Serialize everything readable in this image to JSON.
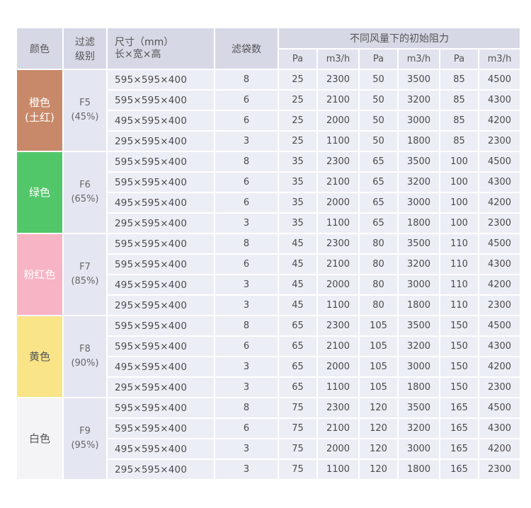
{
  "header": {
    "color": "颜色",
    "grade_line1": "过滤",
    "grade_line2": "级别",
    "size_line1": "尺寸（mm）",
    "size_line2": "长×宽×高",
    "bags": "滤袋数",
    "resistance": "不同风量下的初始阻力",
    "sub": [
      "Pa",
      "m3/h",
      "Pa",
      "m3/h",
      "Pa",
      "m3/h"
    ]
  },
  "groups": [
    {
      "color_line1": "橙色",
      "color_line2": "(土红)",
      "swatch": "#c8896a",
      "swatch_text": "#ffffff",
      "grade": "F5",
      "efficiency": "(45%)",
      "rows": [
        {
          "size": "595×595×400",
          "bags": "8",
          "v": [
            "25",
            "2300",
            "50",
            "3500",
            "85",
            "4500"
          ]
        },
        {
          "size": "595×595×400",
          "bags": "6",
          "v": [
            "25",
            "2100",
            "50",
            "3200",
            "85",
            "4300"
          ]
        },
        {
          "size": "495×595×400",
          "bags": "6",
          "v": [
            "25",
            "2000",
            "50",
            "3000",
            "85",
            "4200"
          ]
        },
        {
          "size": "295×595×400",
          "bags": "3",
          "v": [
            "25",
            "1100",
            "50",
            "1800",
            "85",
            "2300"
          ]
        }
      ]
    },
    {
      "color_line1": "绿色",
      "color_line2": "",
      "swatch": "#52c76a",
      "swatch_text": "#ffffff",
      "grade": "F6",
      "efficiency": "(65%)",
      "rows": [
        {
          "size": "595×595×400",
          "bags": "8",
          "v": [
            "35",
            "2300",
            "65",
            "3500",
            "100",
            "4500"
          ]
        },
        {
          "size": "595×595×400",
          "bags": "6",
          "v": [
            "35",
            "2100",
            "65",
            "3200",
            "100",
            "4300"
          ]
        },
        {
          "size": "495×595×400",
          "bags": "6",
          "v": [
            "35",
            "2000",
            "65",
            "3000",
            "100",
            "4200"
          ]
        },
        {
          "size": "295×595×400",
          "bags": "3",
          "v": [
            "35",
            "1100",
            "65",
            "1800",
            "100",
            "2300"
          ]
        }
      ]
    },
    {
      "color_line1": "粉红色",
      "color_line2": "",
      "swatch": "#f6b4c4",
      "swatch_text": "#ffffff",
      "grade": "F7",
      "efficiency": "(85%)",
      "rows": [
        {
          "size": "595×595×400",
          "bags": "8",
          "v": [
            "45",
            "2300",
            "80",
            "3500",
            "110",
            "4500"
          ]
        },
        {
          "size": "595×595×400",
          "bags": "6",
          "v": [
            "45",
            "2100",
            "80",
            "3200",
            "110",
            "4300"
          ]
        },
        {
          "size": "495×595×400",
          "bags": "3",
          "v": [
            "45",
            "2000",
            "80",
            "3000",
            "110",
            "4200"
          ]
        },
        {
          "size": "295×595×400",
          "bags": "3",
          "v": [
            "45",
            "1100",
            "80",
            "1800",
            "110",
            "2300"
          ]
        }
      ]
    },
    {
      "color_line1": "黄色",
      "color_line2": "",
      "swatch": "#f9e487",
      "swatch_text": "#555555",
      "grade": "F8",
      "efficiency": "(90%)",
      "rows": [
        {
          "size": "595×595×400",
          "bags": "8",
          "v": [
            "65",
            "2300",
            "105",
            "3500",
            "150",
            "4500"
          ]
        },
        {
          "size": "595×595×400",
          "bags": "6",
          "v": [
            "65",
            "2100",
            "105",
            "3200",
            "150",
            "4300"
          ]
        },
        {
          "size": "495×595×400",
          "bags": "3",
          "v": [
            "65",
            "2000",
            "105",
            "3000",
            "150",
            "4200"
          ]
        },
        {
          "size": "295×595×400",
          "bags": "3",
          "v": [
            "65",
            "1100",
            "105",
            "1800",
            "150",
            "2300"
          ]
        }
      ]
    },
    {
      "color_line1": "白色",
      "color_line2": "",
      "swatch": "#f4f4f6",
      "swatch_text": "#555555",
      "grade": "F9",
      "efficiency": "(95%)",
      "rows": [
        {
          "size": "595×595×400",
          "bags": "8",
          "v": [
            "75",
            "2300",
            "120",
            "3500",
            "165",
            "4500"
          ]
        },
        {
          "size": "595×595×400",
          "bags": "6",
          "v": [
            "75",
            "2100",
            "120",
            "3200",
            "165",
            "4300"
          ]
        },
        {
          "size": "495×595×400",
          "bags": "3",
          "v": [
            "75",
            "2000",
            "120",
            "3000",
            "165",
            "4200"
          ]
        },
        {
          "size": "295×595×400",
          "bags": "3",
          "v": [
            "75",
            "1100",
            "120",
            "1800",
            "165",
            "2300"
          ]
        }
      ]
    }
  ]
}
